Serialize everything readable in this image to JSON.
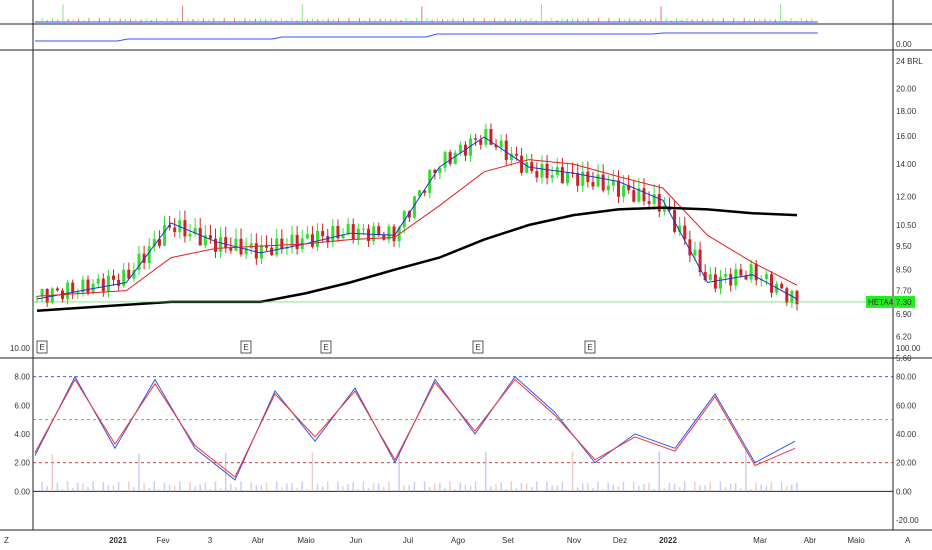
{
  "symbol": "HETA4",
  "last_price_label": "7.30",
  "currency_label": "24 BRL",
  "colors": {
    "up": "#33dd33",
    "down": "#cc2222",
    "ma_fast": "#2233cc",
    "ma_slow": "#dd2222",
    "ma_long": "#000000",
    "osc_k": "#3355ee",
    "osc_d": "#ee3333",
    "tag_bg": "#22ee22",
    "level_high": "#3344dd",
    "level_mid": "#22cc22",
    "level_low": "#cc2222"
  },
  "corner_labels": {
    "left": "Z",
    "right": "A"
  },
  "event_markers": [
    {
      "label": "E",
      "date": "2020-12"
    },
    {
      "label": "E",
      "date": "2021-03"
    },
    {
      "label": "E",
      "date": "2021-05"
    },
    {
      "label": "E",
      "date": "2021-08"
    },
    {
      "label": "E",
      "date": "2021-11"
    }
  ],
  "x_axis_labels": [
    "2021",
    "Fev",
    "3",
    "Abr",
    "Maio",
    "Jun",
    "Jul",
    "Ago",
    "Set",
    "Nov",
    "Dez",
    "2022",
    "Mar",
    "Abr",
    "Maio"
  ],
  "top_panel": {
    "right_tick_labels": [
      "0.00"
    ]
  },
  "price_panel": {
    "right_tick_labels": [
      "20.00",
      "18.00",
      "16.00",
      "14.00",
      "12.00",
      "10.50",
      "9.50",
      "8.50",
      "7.70",
      "6.90",
      "6.20",
      "5.60"
    ]
  },
  "osc_panel": {
    "left_tick_labels": [
      "10.00",
      "8.00",
      "6.00",
      "4.00",
      "2.00",
      "0.00"
    ],
    "right_tick_labels": [
      "100.00",
      "80.00",
      "60.00",
      "40.00",
      "20.00",
      "0.00",
      "-20.00"
    ]
  },
  "chart_data": {
    "type": "line",
    "title": "",
    "symbol": "HETA4",
    "ylim_price": [
      5.6,
      24
    ],
    "price_scale": "log",
    "last_price": 7.3,
    "ohlc_close_approx": {
      "x": [
        "2020-10",
        "2020-11",
        "2020-12",
        "2021-01",
        "2021-02",
        "2021-03",
        "2021-04",
        "2021-05",
        "2021-06",
        "2021-07",
        "2021-08",
        "2021-09",
        "2021-10",
        "2021-11",
        "2021-12",
        "2022-01",
        "2022-02",
        "2022-03"
      ],
      "values": [
        7.5,
        7.8,
        8.2,
        10.5,
        9.6,
        9.3,
        9.8,
        10.2,
        10.0,
        14.0,
        16.0,
        13.6,
        13.2,
        12.5,
        11.5,
        8.0,
        8.4,
        7.3
      ]
    },
    "series": [
      {
        "values": [
          7.4,
          7.7,
          8.0,
          10.6,
          9.7,
          9.2,
          9.6,
          10.1,
          10.0,
          13.8,
          15.9,
          13.8,
          13.4,
          12.9,
          11.8,
          8.0,
          8.3,
          7.4
        ]
      },
      {
        "values": [
          7.5,
          7.6,
          7.7,
          9.0,
          9.4,
          9.5,
          9.6,
          9.8,
          9.9,
          11.5,
          13.5,
          14.3,
          14.0,
          13.2,
          12.5,
          10.0,
          8.8,
          7.9
        ]
      },
      {
        "values": [
          7.0,
          7.1,
          7.2,
          7.3,
          7.3,
          7.3,
          7.6,
          8.0,
          8.5,
          9.0,
          9.8,
          10.5,
          11.0,
          11.3,
          11.4,
          11.3,
          11.1,
          11.0
        ]
      }
    ],
    "oscillator": {
      "ylim": [
        -20,
        100
      ],
      "levels": [
        80,
        50,
        20
      ],
      "series": [
        {
          "values": [
            25,
            80,
            30,
            78,
            30,
            8,
            70,
            35,
            72,
            20,
            78,
            40,
            80,
            55,
            20,
            40,
            30,
            68,
            20,
            35
          ]
        },
        {
          "values": [
            27,
            78,
            33,
            75,
            32,
            10,
            68,
            38,
            70,
            22,
            76,
            42,
            78,
            53,
            22,
            38,
            28,
            66,
            18,
            30
          ]
        }
      ]
    }
  }
}
